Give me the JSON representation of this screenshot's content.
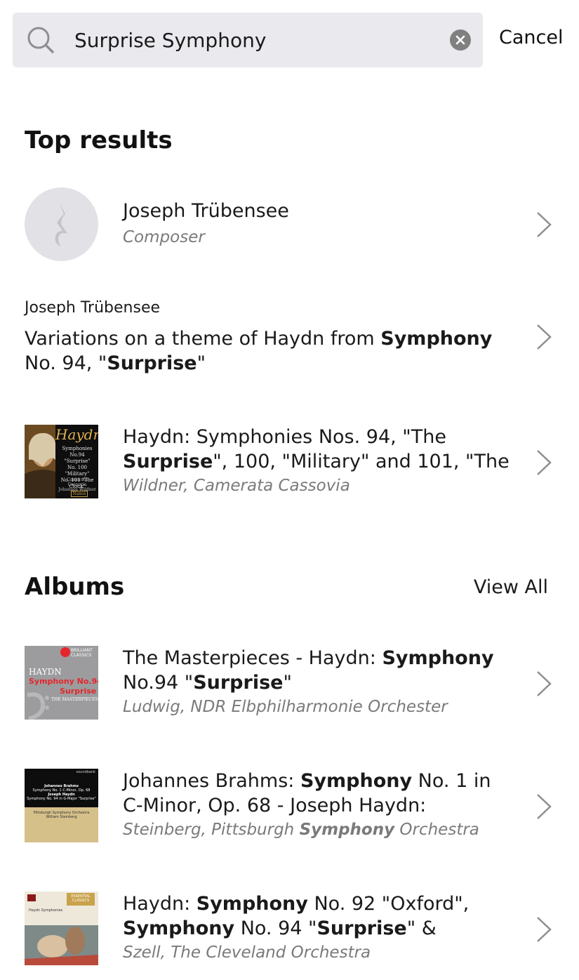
{
  "search": {
    "query": "Surprise Symphony",
    "cancel_label": "Cancel"
  },
  "top_results": {
    "heading": "Top results",
    "composer": {
      "name": "Joseph Trübensee",
      "role": "Composer"
    },
    "work": {
      "composer": "Joseph Trübensee",
      "title_line1_a": "Variations on a theme of Haydn from ",
      "title_line1_b": "Symphony",
      "title_line2_a": "No. 94, \"",
      "title_line2_b": "Surprise",
      "title_line2_c": "\""
    },
    "album": {
      "line1": "Haydn: Symphonies Nos. 94, \"The",
      "line2_bold": "Surprise",
      "line2_rest": "\", 100, \"Military\" and 101, \"The",
      "artists": "Wildner, Camerata Cassovia",
      "cover_title": "Haydn",
      "cover_lines": [
        "Symphonies",
        "No.94 \"Surprise\"",
        "No. 100 \"Military\"",
        "No. 101 \"The Clock\""
      ],
      "cover_footer": [
        "Camerata Cassovia",
        "Johannes Wildner"
      ],
      "cover_brand": "Naxos"
    }
  },
  "albums": {
    "heading": "Albums",
    "view_all": "View All",
    "items": [
      {
        "l1a": "The Masterpieces - Haydn: ",
        "l1b": "Symphony",
        "l2a": "No.94 \"",
        "l2b": "Surprise",
        "l2c": "\"",
        "artists_a": "Ludwig, NDR Elbphilharmonie Orchester",
        "artists_b": "",
        "artists_c": "",
        "cover": {
          "brand": "BRILLIANT CLASSICS",
          "l1": "HAYDN",
          "l2": "Symphony No.94",
          "l3": "Surprise",
          "l4": "THE MASTERPIECES"
        }
      },
      {
        "l1a": "Johannes Brahms: ",
        "l1b": "Symphony",
        "l1c": " No. 1 in",
        "l2a": "C-Minor, Op. 68 - Joseph Haydn:",
        "artists_a": "Steinberg, Pittsburgh ",
        "artists_b": "Symphony",
        "artists_c": " Orchestra",
        "cover": {
          "brand": "soundbank",
          "l1": "Johannes Brahms",
          "l2": "Symphony No. 1 C-Minor, Op. 68",
          "l3": "Joseph Haydn",
          "l4": "Symphony No. 94 in G-Major \"Surprise\"",
          "l5": "Pittsburgh Symphony Orchestra",
          "l6": "William Steinberg"
        }
      },
      {
        "l1a": "Haydn: ",
        "l1b": "Symphony",
        "l1c": " No. 92 \"Oxford\",",
        "l2a": "Symphony",
        "l2b": " No. 94 \"",
        "l2c": "Surprise",
        "l2d": "\" &",
        "artists_a": "Szell, The Cleveland Orchestra",
        "cover": {
          "brand": "ESSENTIAL CLASSICS",
          "l1": "Haydn Symphonies"
        }
      }
    ]
  },
  "colors": {
    "search_bg": "#e9e9ee",
    "chevron": "#8e8e93",
    "subtitle": "#7a7a7a"
  }
}
